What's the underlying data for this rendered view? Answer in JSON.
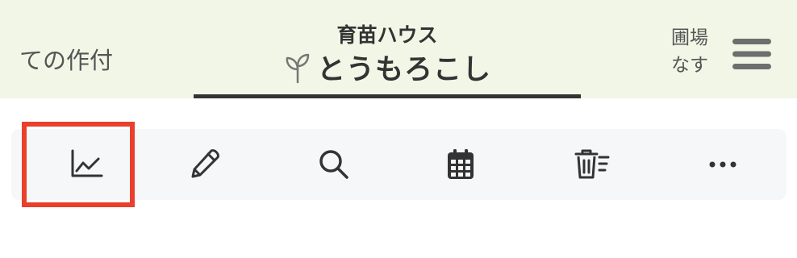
{
  "tabs": {
    "left_partial_label": "ての作付",
    "current": {
      "subtitle": "育苗ハウス",
      "title": "とうもろこし",
      "icon": "sprout-icon"
    },
    "right_partial": {
      "line1": "圃場",
      "line2": "なす"
    }
  },
  "menu": {
    "icon": "hamburger-menu-icon"
  },
  "toolbar": {
    "items": [
      {
        "icon": "chart-line-icon",
        "highlighted": true
      },
      {
        "icon": "pencil-icon"
      },
      {
        "icon": "search-icon"
      },
      {
        "icon": "calendar-icon"
      },
      {
        "icon": "trash-list-icon"
      },
      {
        "icon": "more-dots-icon"
      }
    ]
  },
  "colors": {
    "tab_background": "#f1f6e6",
    "active_underline": "#333333",
    "toolbar_background": "#f6f7f8",
    "highlight": "#e8402c",
    "icon": "#333333"
  }
}
